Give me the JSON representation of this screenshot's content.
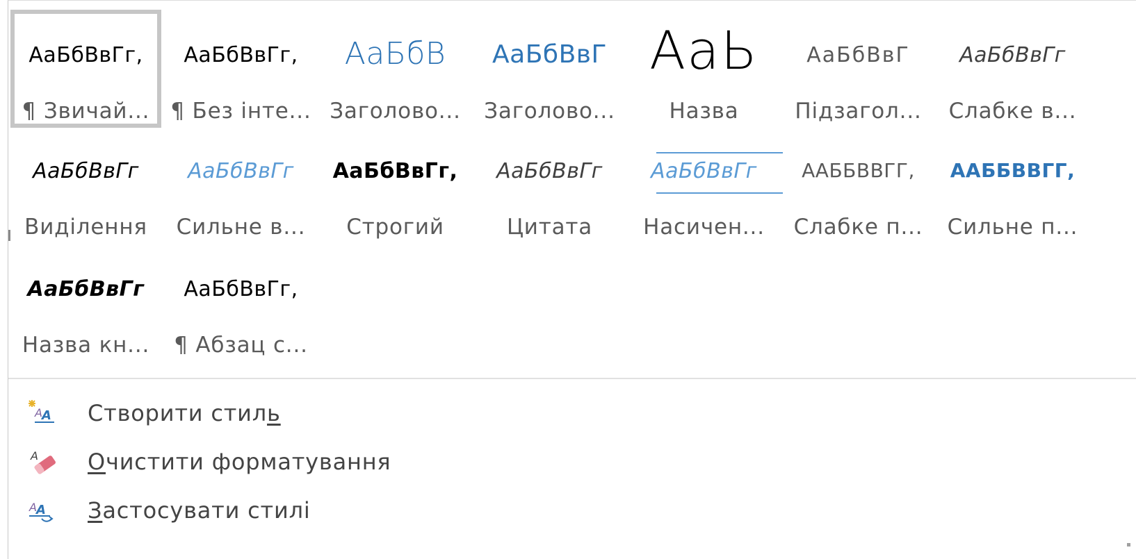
{
  "styles_gallery": {
    "rows": [
      [
        {
          "preview": "АаБбВвГг,",
          "caption": "¶ Звичай...",
          "selected": true
        },
        {
          "preview": "АаБбВвГг,",
          "caption": "¶ Без інте..."
        },
        {
          "preview": "АаБбВ",
          "caption": "Заголово..."
        },
        {
          "preview": "АаБбВвГ",
          "caption": "Заголово..."
        },
        {
          "preview": "АаЬ",
          "caption": "Назва"
        },
        {
          "preview": "АаБбВвГ",
          "caption": "Підзагол..."
        },
        {
          "preview": "АаБбВвГг",
          "caption": "Слабке в..."
        }
      ],
      [
        {
          "preview": "АаБбВвГг",
          "caption": "Виділення"
        },
        {
          "preview": "АаБбВвГг",
          "caption": "Сильне в..."
        },
        {
          "preview": "АаБбВвГг,",
          "caption": "Строгий"
        },
        {
          "preview": "АаБбВвГг",
          "caption": "Цитата"
        },
        {
          "preview": "АаБбВвГг",
          "caption": "Насичен..."
        },
        {
          "preview": "ААБбВвГг,",
          "caption": "Слабке п..."
        },
        {
          "preview": "ААБбВвГг,",
          "caption": "Сильне п..."
        }
      ],
      [
        {
          "preview": "АаБбВвГг",
          "caption": "Назва кн..."
        },
        {
          "preview": "АаБбВвГг,",
          "caption": "¶ Абзац с..."
        }
      ]
    ]
  },
  "menu": {
    "create_style": {
      "icon": "new-style-icon",
      "label_before": "Створити стил",
      "mnemonic": "ь",
      "label_after": ""
    },
    "clear_formatting": {
      "icon": "eraser-icon",
      "label_before": "",
      "mnemonic": "О",
      "label_after": "чистити форматування"
    },
    "apply_styles": {
      "icon": "apply-styles-icon",
      "label_before": "",
      "mnemonic": "З",
      "label_after": "астосувати стилі"
    }
  },
  "colors": {
    "heading_blue": "#2e74b5",
    "subtle_gray": "#595959",
    "selection_border": "#c6c6c6"
  }
}
